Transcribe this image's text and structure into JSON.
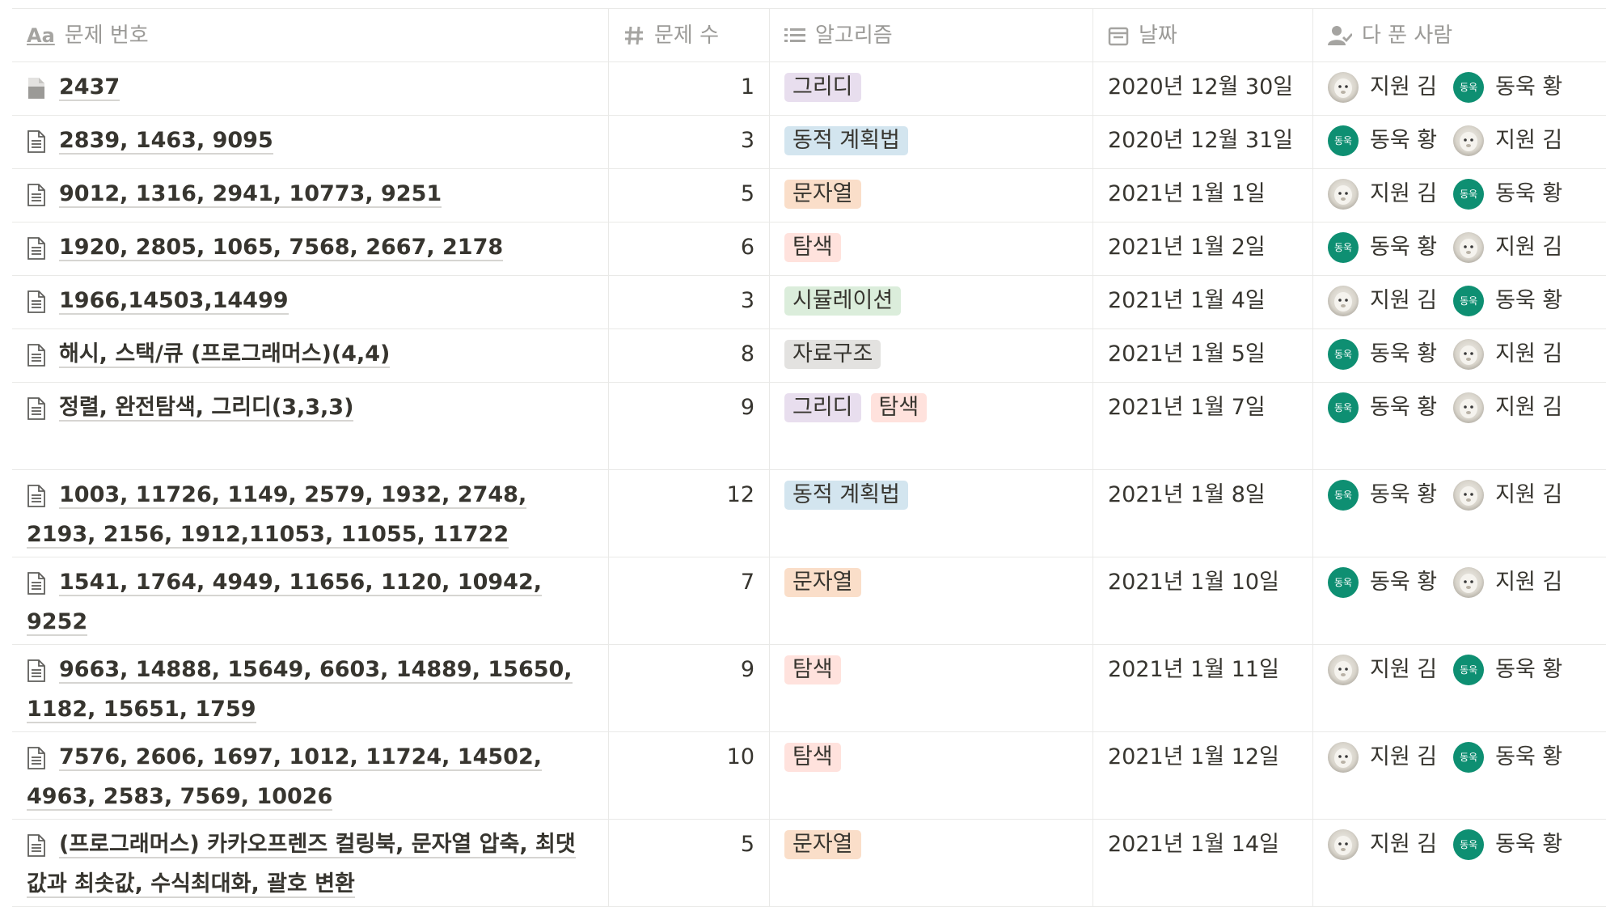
{
  "header": {
    "title_col": "문제 번호",
    "count_col": "문제 수",
    "algo_col": "알고리즘",
    "date_col": "날짜",
    "people_col": "다 푼 사람",
    "title_icon_text": "Aa"
  },
  "avatar_initials": "동욱",
  "rows": [
    {
      "title": "2437",
      "count": "1",
      "tags": [
        {
          "label": "그리디",
          "color": "purple"
        }
      ],
      "date": "2020년 12월 30일",
      "people": [
        {
          "name": "지원 김",
          "avatar": "photo"
        },
        {
          "name": "동욱 황",
          "avatar": "green"
        }
      ],
      "h": 66
    },
    {
      "title": "2839, 1463, 9095",
      "count": "3",
      "tags": [
        {
          "label": "동적 계획법",
          "color": "blue"
        }
      ],
      "date": "2020년 12월 31일",
      "people": [
        {
          "name": "동욱 황",
          "avatar": "green"
        },
        {
          "name": "지원 김",
          "avatar": "photo"
        }
      ],
      "h": 66
    },
    {
      "title": "9012, 1316, 2941, 10773, 9251",
      "count": "5",
      "tags": [
        {
          "label": "문자열",
          "color": "orange"
        }
      ],
      "date": "2021년 1월 1일",
      "people": [
        {
          "name": "지원 김",
          "avatar": "photo"
        },
        {
          "name": "동욱 황",
          "avatar": "green"
        }
      ],
      "h": 66
    },
    {
      "title": "1920, 2805, 1065, 7568, 2667, 2178",
      "count": "6",
      "tags": [
        {
          "label": "탐색",
          "color": "red"
        }
      ],
      "date": "2021년 1월 2일",
      "people": [
        {
          "name": "동욱 황",
          "avatar": "green"
        },
        {
          "name": "지원 김",
          "avatar": "photo"
        }
      ],
      "h": 66
    },
    {
      "title": "1966,14503,14499",
      "count": "3",
      "tags": [
        {
          "label": "시뮬레이션",
          "color": "green"
        }
      ],
      "date": "2021년 1월 4일",
      "people": [
        {
          "name": "지원 김",
          "avatar": "photo"
        },
        {
          "name": "동욱 황",
          "avatar": "green"
        }
      ],
      "h": 66
    },
    {
      "title": "해시, 스택/큐 (프로그래머스)(4,4)",
      "count": "8",
      "tags": [
        {
          "label": "자료구조",
          "color": "gray"
        }
      ],
      "date": "2021년 1월 5일",
      "people": [
        {
          "name": "동욱 황",
          "avatar": "green"
        },
        {
          "name": "지원 김",
          "avatar": "photo"
        }
      ],
      "h": 66
    },
    {
      "title": "정렬, 완전탐색, 그리디(3,3,3)",
      "count": "9",
      "tags": [
        {
          "label": "그리디",
          "color": "purple"
        },
        {
          "label": "탐색",
          "color": "red"
        }
      ],
      "date": "2021년 1월 7일",
      "people": [
        {
          "name": "동욱 황",
          "avatar": "green"
        },
        {
          "name": "지원 김",
          "avatar": "photo"
        }
      ],
      "h": 108
    },
    {
      "title": "1003, 11726, 1149, 2579, 1932, 2748, 2193, 2156, 1912,11053, 11055, 11722",
      "count": "12",
      "tags": [
        {
          "label": "동적 계획법",
          "color": "blue"
        }
      ],
      "date": "2021년 1월 8일",
      "people": [
        {
          "name": "동욱 황",
          "avatar": "green"
        },
        {
          "name": "지원 김",
          "avatar": "photo"
        }
      ],
      "h": 108
    },
    {
      "title": "1541, 1764, 4949, 11656, 1120, 10942, 9252",
      "count": "7",
      "tags": [
        {
          "label": "문자열",
          "color": "orange"
        }
      ],
      "date": "2021년 1월 10일",
      "people": [
        {
          "name": "동욱 황",
          "avatar": "green"
        },
        {
          "name": "지원 김",
          "avatar": "photo"
        }
      ],
      "h": 108
    },
    {
      "title": "9663, 14888, 15649, 6603, 14889, 15650, 1182, 15651, 1759",
      "count": "9",
      "tags": [
        {
          "label": "탐색",
          "color": "red"
        }
      ],
      "date": "2021년 1월 11일",
      "people": [
        {
          "name": "지원 김",
          "avatar": "photo"
        },
        {
          "name": "동욱 황",
          "avatar": "green"
        }
      ],
      "h": 108
    },
    {
      "title": "7576, 2606, 1697, 1012, 11724, 14502, 4963, 2583, 7569, 10026",
      "count": "10",
      "tags": [
        {
          "label": "탐색",
          "color": "red"
        }
      ],
      "date": "2021년 1월 12일",
      "people": [
        {
          "name": "지원 김",
          "avatar": "photo"
        },
        {
          "name": "동욱 황",
          "avatar": "green"
        }
      ],
      "h": 108
    },
    {
      "title": "(프로그래머스) 카카오프렌즈 컬링북, 문자열 압축, 최댓값과 최솟값, 수식최대화, 괄호 변환",
      "count": "5",
      "tags": [
        {
          "label": "문자열",
          "color": "orange"
        }
      ],
      "date": "2021년 1월 14일",
      "people": [
        {
          "name": "지원 김",
          "avatar": "photo"
        },
        {
          "name": "동욱 황",
          "avatar": "green"
        }
      ],
      "h": 108
    }
  ]
}
